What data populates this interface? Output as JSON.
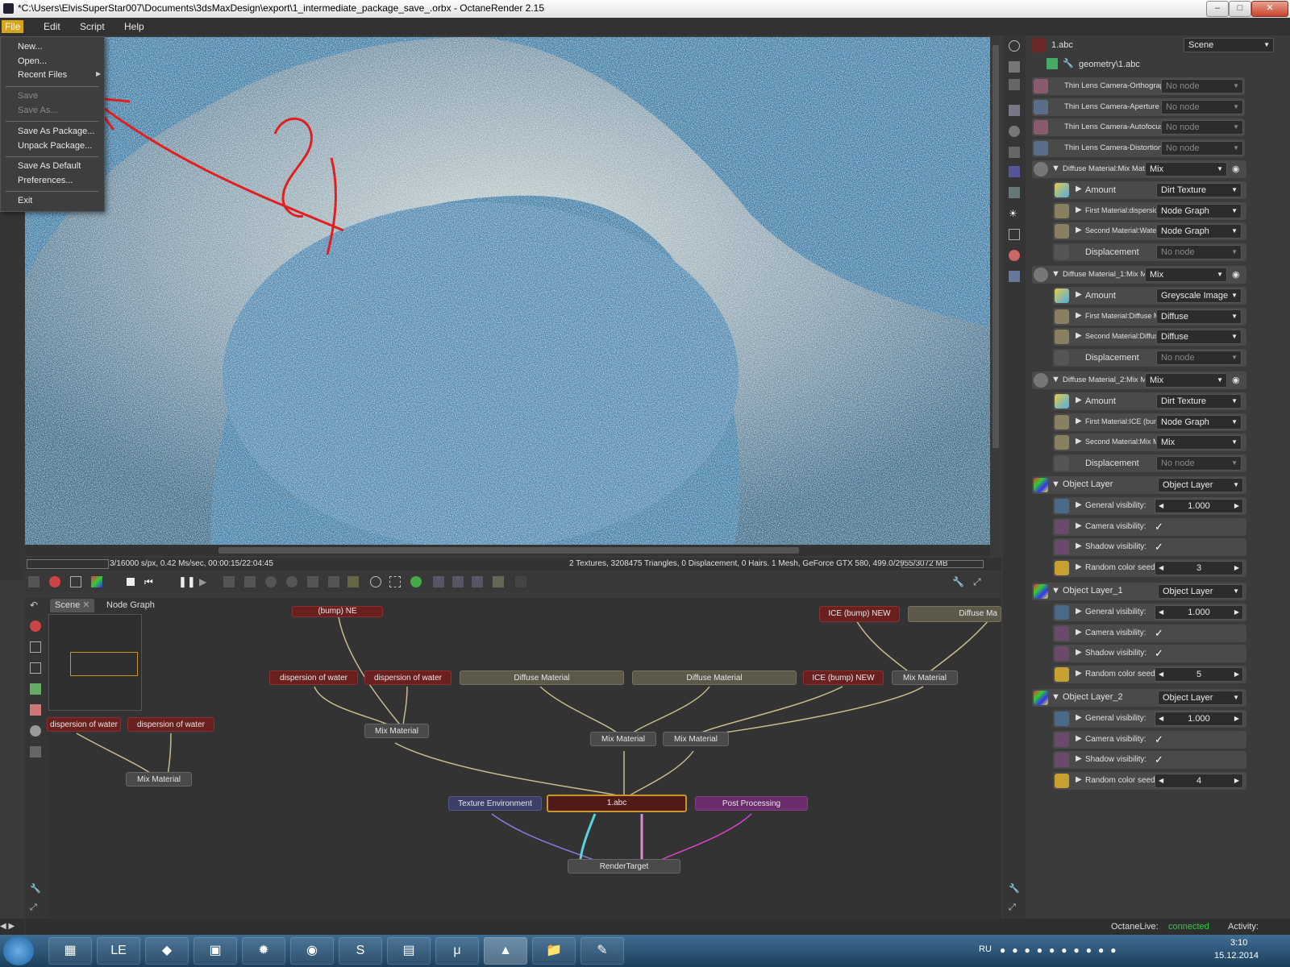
{
  "window": {
    "title": "*C:\\Users\\ElvisSuperStar007\\Documents\\3dsMaxDesign\\export\\1_intermediate_package_save_.orbx - OctaneRender 2.15"
  },
  "menubar": {
    "items": [
      "File",
      "Edit",
      "Script",
      "Help"
    ]
  },
  "file_menu": {
    "items": [
      {
        "label": "New...",
        "enabled": true
      },
      {
        "label": "Open...",
        "enabled": true
      },
      {
        "label": "Recent Files",
        "enabled": true,
        "submenu": true
      },
      {
        "label": "Save",
        "enabled": false
      },
      {
        "label": "Save As...",
        "enabled": false
      },
      {
        "label": "Save As Package...",
        "enabled": true
      },
      {
        "label": "Unpack Package...",
        "enabled": true
      },
      {
        "label": "Save As Default",
        "enabled": true
      },
      {
        "label": "Preferences...",
        "enabled": true
      },
      {
        "label": "Exit",
        "enabled": true
      }
    ]
  },
  "status": {
    "left": "3/16000 s/px, 0.42 Ms/sec, 00:00:15/22:04:45",
    "right": "2 Textures, 3208475 Triangles, 0 Displacement, 0 Hairs. 1 Mesh, GeForce GTX 580, 499.0/2955/3072 MB"
  },
  "nodegraph": {
    "tabs": [
      "Scene",
      "Node Graph"
    ],
    "nodes": {
      "top_left": "(bump) NE",
      "top_ice": "ICE (bump) NEW",
      "top_diffuse": "Diffuse Ma",
      "water1": "dispersion of water",
      "water2": "dispersion of water",
      "water3": "dispersion of water",
      "water4": "dispersion of water",
      "diffuse1": "Diffuse Material",
      "diffuse2": "Diffuse Material",
      "ice": "ICE (bump) NEW",
      "mix1": "Mix Material",
      "mix2": "Mix Material",
      "mix3": "Mix Material",
      "mix4": "Mix Material",
      "mix5": "Mix Material",
      "texenv": "Texture Environment",
      "abc": "1.abc",
      "post": "Post Processing",
      "render": "RenderTarget"
    }
  },
  "panel": {
    "header_name": "1.abc",
    "header_select": "Scene",
    "geometry": "geometry\\1.abc",
    "rows": [
      {
        "label": "Thin Lens Camera-Orthographic",
        "value": "No node",
        "off": true,
        "color": "#8a5a6e"
      },
      {
        "label": "Thin Lens Camera-Aperture edge",
        "value": "No node",
        "off": true,
        "color": "#5a6e8a"
      },
      {
        "label": "Thin Lens Camera-Autofocus",
        "value": "No node",
        "off": true,
        "color": "#8a5a6e"
      },
      {
        "label": "Thin Lens Camera-Distortion",
        "value": "No node",
        "off": true,
        "color": "#5a6e8a"
      }
    ],
    "groups": [
      {
        "label": "Diffuse Material:Mix Material",
        "value": "Mix",
        "children": [
          {
            "label": "Amount",
            "value": "Dirt Texture"
          },
          {
            "label": "First Material:dispersio...",
            "value": "Node Graph"
          },
          {
            "label": "Second Material:Water ...",
            "value": "Node Graph"
          },
          {
            "label": "Displacement",
            "value": "No node",
            "off": true
          }
        ]
      },
      {
        "label": "Diffuse Material_1:Mix Ma...",
        "value": "Mix",
        "children": [
          {
            "label": "Amount",
            "value": "Greyscale Image"
          },
          {
            "label": "First Material:Diffuse M...",
            "value": "Diffuse"
          },
          {
            "label": "Second Material:Diffuse...",
            "value": "Diffuse"
          },
          {
            "label": "Displacement",
            "value": "No node",
            "off": true
          }
        ]
      },
      {
        "label": "Diffuse Material_2:Mix Ma...",
        "value": "Mix",
        "children": [
          {
            "label": "Amount",
            "value": "Dirt Texture"
          },
          {
            "label": "First Material:ICE (bum...",
            "value": "Node Graph"
          },
          {
            "label": "Second Material:Mix M...",
            "value": "Mix"
          },
          {
            "label": "Displacement",
            "value": "No node",
            "off": true
          }
        ]
      }
    ],
    "layers": [
      {
        "label": "Object Layer",
        "value": "Object Layer",
        "general": "1.000",
        "camera": "Camera visibility:",
        "shadow": "Shadow visibility:",
        "seed": "3"
      },
      {
        "label": "Object Layer_1",
        "value": "Object Layer",
        "general": "1.000",
        "camera": "Camera visibility:",
        "shadow": "Shadow visibility:",
        "seed": "5"
      },
      {
        "label": "Object Layer_2",
        "value": "Object Layer",
        "general": "1.000",
        "camera": "Camera visibility:",
        "shadow": "Shadow visibility:",
        "seed": "4"
      }
    ],
    "labels": {
      "general": "General visibility:",
      "seed": "Random color seed:"
    }
  },
  "bottom": {
    "live_label": "OctaneLive:",
    "live_status": "connected",
    "activity": "Activity:"
  },
  "taskbar": {
    "lang": "RU",
    "time": "3:10",
    "date": "15.12.2014"
  },
  "colors": {
    "accent": "#d6a51d",
    "connected": "#2ecc40"
  }
}
